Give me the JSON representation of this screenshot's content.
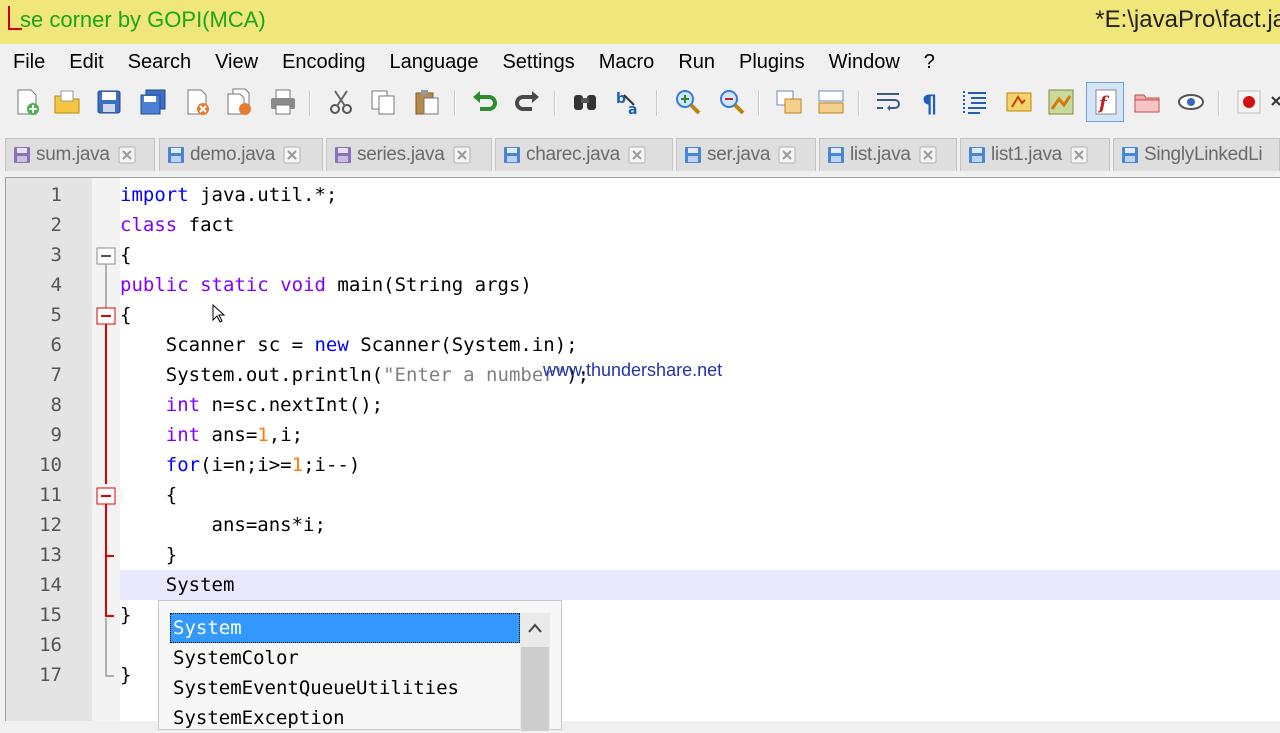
{
  "window": {
    "title_left": "se corner by GOPI(MCA)",
    "title_right": "*E:\\javaPro\\fact.ja"
  },
  "menu": [
    "File",
    "Edit",
    "Search",
    "View",
    "Encoding",
    "Language",
    "Settings",
    "Macro",
    "Run",
    "Plugins",
    "Window",
    "?"
  ],
  "toolbar": {
    "icons": [
      "new-file-icon",
      "open-file-icon",
      "save-icon",
      "save-all-icon",
      "close-icon",
      "close-all-icon",
      "print-icon",
      "cut-icon",
      "copy-icon",
      "paste-icon",
      "undo-icon",
      "redo-icon",
      "find-icon",
      "replace-icon",
      "zoom-in-icon",
      "zoom-out-icon",
      "sync-vertical-icon",
      "sync-horizontal-icon",
      "word-wrap-icon",
      "show-all-chars-icon",
      "indent-guide-icon",
      "udl-icon",
      "doc-map-icon",
      "function-list-icon",
      "folder-workspace-icon",
      "monitoring-icon",
      "record-macro-icon"
    ]
  },
  "tabs": [
    {
      "label": "sum.java",
      "state": "saved"
    },
    {
      "label": "demo.java",
      "state": "unsaved"
    },
    {
      "label": "series.java",
      "state": "saved"
    },
    {
      "label": "charec.java",
      "state": "unsaved"
    },
    {
      "label": "ser.java",
      "state": "unsaved"
    },
    {
      "label": "list.java",
      "state": "unsaved"
    },
    {
      "label": "list1.java",
      "state": "unsaved"
    },
    {
      "label": "SinglyLinkedLi",
      "state": "unsaved"
    }
  ],
  "editor": {
    "line_numbers": [
      "1",
      "2",
      "3",
      "4",
      "5",
      "6",
      "7",
      "8",
      "9",
      "10",
      "11",
      "12",
      "13",
      "14",
      "15",
      "16",
      "17"
    ],
    "lines": {
      "l1_kw": "import",
      "l1_rest": " java.util.*;",
      "l2_kw": "class",
      "l2_rest": " fact",
      "l3": "{",
      "l4_kw1": "public",
      "l4_kw2": "static",
      "l4_kw3": "void",
      "l4_rest": " main(String args)",
      "l5": "{",
      "l6_a": "    Scanner sc = ",
      "l6_kw": "new",
      "l6_b": " Scanner(System.in);",
      "l7_a": "    System.out.println(",
      "l7_str": "\"Enter a number\"",
      "l7_b": ");",
      "l8_kw": "int",
      "l8_rest": " n=sc.nextInt();",
      "l9_kw": "int",
      "l9_a": " ans=",
      "l9_num": "1",
      "l9_b": ",i;",
      "l10_kw": "for",
      "l10_a": "(i=n;i>=",
      "l10_num": "1",
      "l10_b": ";i--)",
      "l11": "    {",
      "l12": "        ans=ans*i;",
      "l13": "    }",
      "l14": "    System",
      "l15": "}",
      "l17": "}"
    },
    "watermark": "www.thundershare.net"
  },
  "autocomplete": {
    "items": [
      "System",
      "SystemColor",
      "SystemEventQueueUtilities",
      "SystemException"
    ],
    "selected_index": 0
  },
  "colors": {
    "titlebar_bg": "#f1e67a",
    "keyword": "#0000ff",
    "keyword2": "#8000ff",
    "number": "#ff8000",
    "selection": "#3399ff",
    "fold_marker": "#e00000"
  }
}
